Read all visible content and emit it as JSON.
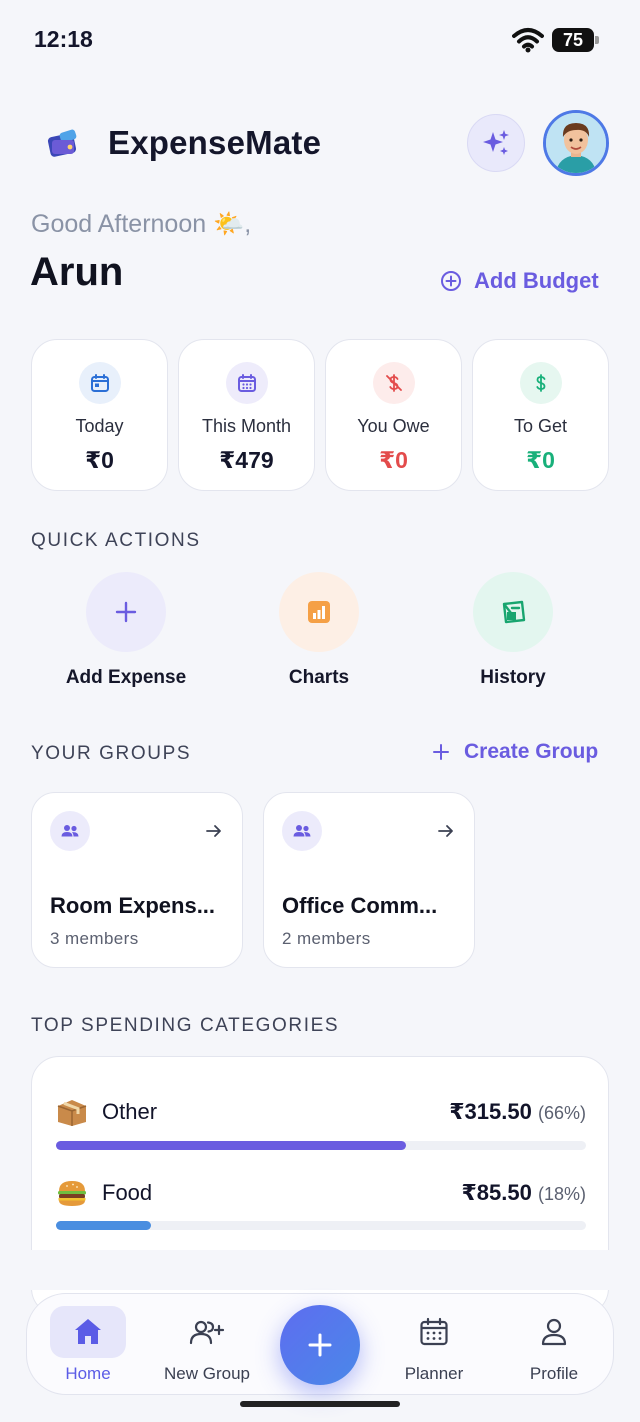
{
  "status_bar": {
    "time": "12:18",
    "battery": "75"
  },
  "header": {
    "app_name": "ExpenseMate"
  },
  "greeting": {
    "text": "Good Afternoon 🌤️,",
    "name": "Arun",
    "add_budget": "Add Budget"
  },
  "stats": [
    {
      "label": "Today",
      "value": "₹0",
      "icon": "calendar-icon",
      "color": "#2b6fd6"
    },
    {
      "label": "This Month",
      "value": "₹479",
      "icon": "calendar-grid-icon",
      "color": "#6a5ce0"
    },
    {
      "label": "You Owe",
      "value": "₹0",
      "icon": "dollar-strike-icon",
      "color": "#e34b4b"
    },
    {
      "label": "To Get",
      "value": "₹0",
      "icon": "dollar-icon",
      "color": "#18b07a"
    }
  ],
  "quick_actions": {
    "title": "QUICK ACTIONS",
    "items": [
      {
        "label": "Add Expense",
        "icon": "plus-icon"
      },
      {
        "label": "Charts",
        "icon": "chart-icon"
      },
      {
        "label": "History",
        "icon": "history-icon"
      }
    ]
  },
  "groups": {
    "title": "YOUR GROUPS",
    "create_label": "Create Group",
    "items": [
      {
        "name": "Room Expens...",
        "members": "3 members"
      },
      {
        "name": "Office Comm...",
        "members": "2 members"
      }
    ]
  },
  "categories": {
    "title": "TOP SPENDING CATEGORIES",
    "items": [
      {
        "emoji": "📦",
        "name": "Other",
        "amount": "₹315.50",
        "percent": "(66%)",
        "fraction": 0.66,
        "color": "#6a5ce0"
      },
      {
        "emoji": "🍔",
        "name": "Food",
        "amount": "₹85.50",
        "percent": "(18%)",
        "fraction": 0.18,
        "color": "#4a8ee0"
      }
    ]
  },
  "nav": {
    "items": [
      {
        "label": "Home",
        "active": true
      },
      {
        "label": "New Group"
      },
      {
        "label": "Planner"
      },
      {
        "label": "Profile"
      }
    ]
  }
}
